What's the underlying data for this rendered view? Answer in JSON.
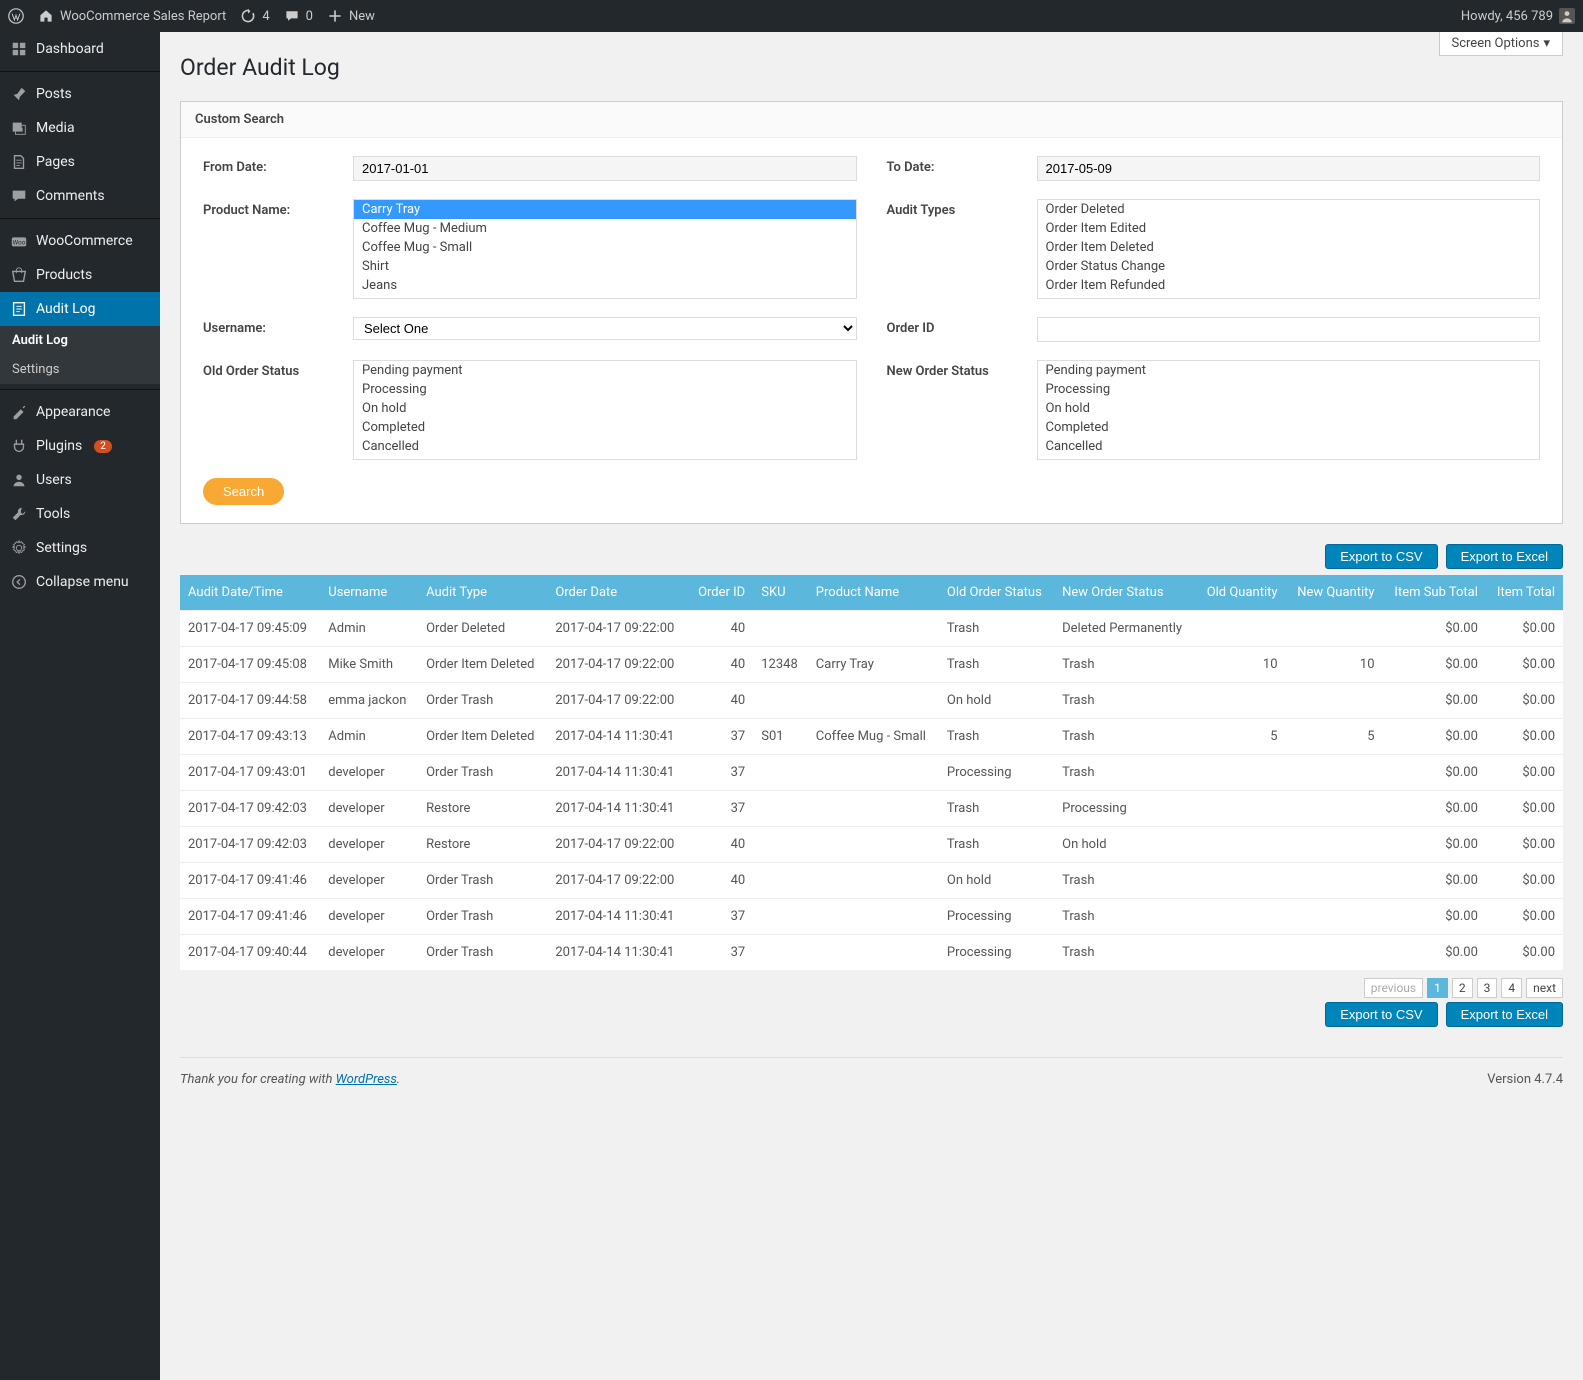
{
  "topbar": {
    "site_name": "WooCommerce Sales Report",
    "updates_count": "4",
    "comments_count": "0",
    "new_label": "New",
    "howdy": "Howdy, 456 789"
  },
  "sidebar": {
    "items": [
      {
        "label": "Dashboard",
        "icon": "dashboard"
      },
      {
        "label": "Posts",
        "icon": "pin"
      },
      {
        "label": "Media",
        "icon": "media"
      },
      {
        "label": "Pages",
        "icon": "page"
      },
      {
        "label": "Comments",
        "icon": "comment"
      },
      {
        "label": "WooCommerce",
        "icon": "woo"
      },
      {
        "label": "Products",
        "icon": "products"
      },
      {
        "label": "Audit Log",
        "icon": "audit",
        "active": true
      },
      {
        "label": "Appearance",
        "icon": "appearance"
      },
      {
        "label": "Plugins",
        "icon": "plugins",
        "badge": "2"
      },
      {
        "label": "Users",
        "icon": "users"
      },
      {
        "label": "Tools",
        "icon": "tools"
      },
      {
        "label": "Settings",
        "icon": "settings"
      },
      {
        "label": "Collapse menu",
        "icon": "collapse"
      }
    ],
    "submenu": [
      {
        "label": "Audit Log",
        "current": true
      },
      {
        "label": "Settings"
      }
    ]
  },
  "screen_options": "Screen Options",
  "page_title": "Order Audit Log",
  "panel_title": "Custom Search",
  "form": {
    "from_date_label": "From Date:",
    "from_date_value": "2017-01-01",
    "to_date_label": "To Date:",
    "to_date_value": "2017-05-09",
    "product_name_label": "Product Name:",
    "product_options": [
      "Carry Tray",
      "Coffee Mug - Medium",
      "Coffee Mug - Small",
      "Shirt",
      "Jeans"
    ],
    "audit_types_label": "Audit Types",
    "audit_options": [
      "Order Deleted",
      "Order Item Edited",
      "Order Item Deleted",
      "Order Status Change",
      "Order Item Refunded"
    ],
    "username_label": "Username:",
    "username_selected": "Select One",
    "order_id_label": "Order ID",
    "old_status_label": "Old Order Status",
    "new_status_label": "New Order Status",
    "status_options": [
      "Pending payment",
      "Processing",
      "On hold",
      "Completed",
      "Cancelled"
    ],
    "search_btn": "Search"
  },
  "export_csv": "Export to CSV",
  "export_excel": "Export to Excel",
  "table": {
    "headers": [
      "Audit Date/Time",
      "Username",
      "Audit Type",
      "Order Date",
      "Order ID",
      "SKU",
      "Product Name",
      "Old Order Status",
      "New Order Status",
      "Old Quantity",
      "New Quantity",
      "Item Sub Total",
      "Item Total"
    ],
    "rows": [
      {
        "dt": "2017-04-17 09:45:09",
        "user": "Admin",
        "type": "Order Deleted",
        "odate": "2017-04-17 09:22:00",
        "oid": "40",
        "sku": "",
        "pname": "",
        "old": "Trash",
        "new": "Deleted Permanently",
        "oq": "",
        "nq": "",
        "sub": "$0.00",
        "tot": "$0.00"
      },
      {
        "dt": "2017-04-17 09:45:08",
        "user": "Mike Smith",
        "type": "Order Item Deleted",
        "odate": "2017-04-17 09:22:00",
        "oid": "40",
        "sku": "12348",
        "pname": "Carry Tray",
        "old": "Trash",
        "new": "Trash",
        "oq": "10",
        "nq": "10",
        "sub": "$0.00",
        "tot": "$0.00"
      },
      {
        "dt": "2017-04-17 09:44:58",
        "user": "emma jackon",
        "type": "Order Trash",
        "odate": "2017-04-17 09:22:00",
        "oid": "40",
        "sku": "",
        "pname": "",
        "old": "On hold",
        "new": "Trash",
        "oq": "",
        "nq": "",
        "sub": "$0.00",
        "tot": "$0.00"
      },
      {
        "dt": "2017-04-17 09:43:13",
        "user": "Admin",
        "type": "Order Item Deleted",
        "odate": "2017-04-14 11:30:41",
        "oid": "37",
        "sku": "S01",
        "pname": "Coffee Mug - Small",
        "old": "Trash",
        "new": "Trash",
        "oq": "5",
        "nq": "5",
        "sub": "$0.00",
        "tot": "$0.00"
      },
      {
        "dt": "2017-04-17 09:43:01",
        "user": "developer",
        "type": "Order Trash",
        "odate": "2017-04-14 11:30:41",
        "oid": "37",
        "sku": "",
        "pname": "",
        "old": "Processing",
        "new": "Trash",
        "oq": "",
        "nq": "",
        "sub": "$0.00",
        "tot": "$0.00"
      },
      {
        "dt": "2017-04-17 09:42:03",
        "user": "developer",
        "type": "Restore",
        "odate": "2017-04-14 11:30:41",
        "oid": "37",
        "sku": "",
        "pname": "",
        "old": "Trash",
        "new": "Processing",
        "oq": "",
        "nq": "",
        "sub": "$0.00",
        "tot": "$0.00"
      },
      {
        "dt": "2017-04-17 09:42:03",
        "user": "developer",
        "type": "Restore",
        "odate": "2017-04-17 09:22:00",
        "oid": "40",
        "sku": "",
        "pname": "",
        "old": "Trash",
        "new": "On hold",
        "oq": "",
        "nq": "",
        "sub": "$0.00",
        "tot": "$0.00"
      },
      {
        "dt": "2017-04-17 09:41:46",
        "user": "developer",
        "type": "Order Trash",
        "odate": "2017-04-17 09:22:00",
        "oid": "40",
        "sku": "",
        "pname": "",
        "old": "On hold",
        "new": "Trash",
        "oq": "",
        "nq": "",
        "sub": "$0.00",
        "tot": "$0.00"
      },
      {
        "dt": "2017-04-17 09:41:46",
        "user": "developer",
        "type": "Order Trash",
        "odate": "2017-04-14 11:30:41",
        "oid": "37",
        "sku": "",
        "pname": "",
        "old": "Processing",
        "new": "Trash",
        "oq": "",
        "nq": "",
        "sub": "$0.00",
        "tot": "$0.00"
      },
      {
        "dt": "2017-04-17 09:40:44",
        "user": "developer",
        "type": "Order Trash",
        "odate": "2017-04-14 11:30:41",
        "oid": "37",
        "sku": "",
        "pname": "",
        "old": "Processing",
        "new": "Trash",
        "oq": "",
        "nq": "",
        "sub": "$0.00",
        "tot": "$0.00"
      }
    ]
  },
  "pager": {
    "previous": "previous",
    "pages": [
      "1",
      "2",
      "3",
      "4"
    ],
    "next": "next"
  },
  "footer": {
    "thanks_pre": "Thank you for creating with ",
    "thanks_link": "WordPress",
    "version": "Version 4.7.4"
  }
}
